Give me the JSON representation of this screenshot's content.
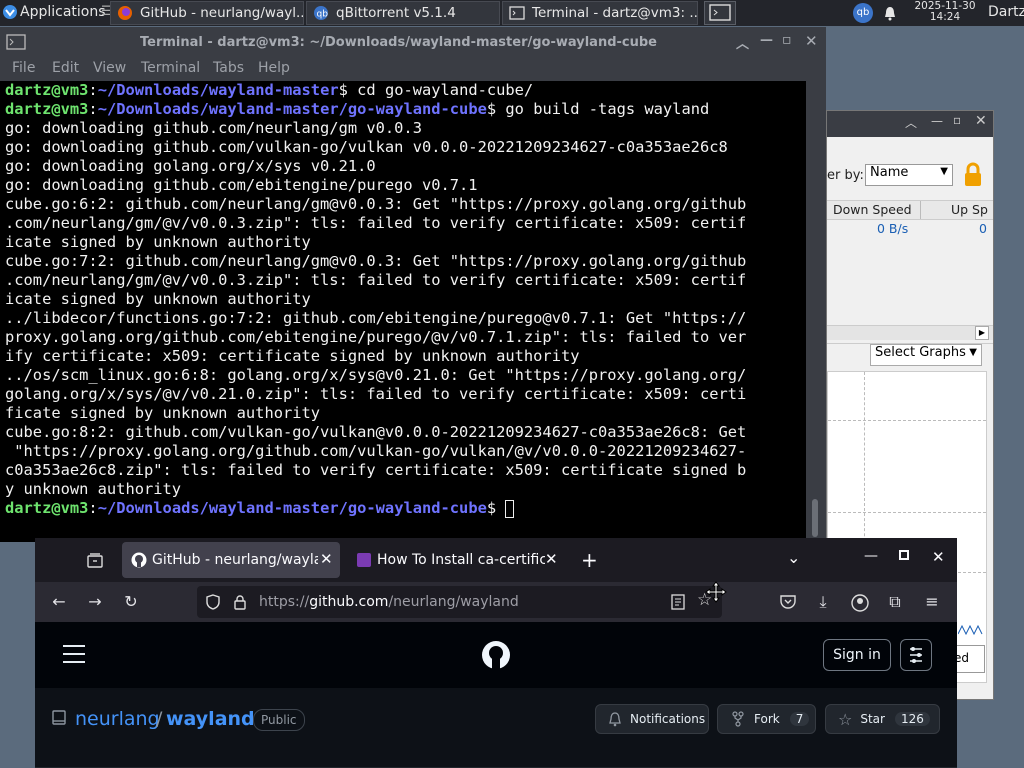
{
  "panel": {
    "applications_label": "Applications",
    "tasks": [
      {
        "label": "GitHub - neurlang/wayl..."
      },
      {
        "label": "qBittorrent v5.1.4"
      },
      {
        "label": "Terminal - dartz@vm3: ..."
      }
    ],
    "date": "2025-11-30",
    "time": "14:24",
    "user": "Dartz",
    "qb_tray": "qb"
  },
  "terminal": {
    "title": "Terminal - dartz@vm3: ~/Downloads/wayland-master/go-wayland-cube",
    "menu": [
      "File",
      "Edit",
      "View",
      "Terminal",
      "Tabs",
      "Help"
    ],
    "prompt_user": "dartz@vm3",
    "lines": [
      {
        "path": "~/Downloads/wayland-master",
        "cmd": "$ cd go-wayland-cube/"
      },
      {
        "path": "~/Downloads/wayland-master/go-wayland-cube",
        "cmd": "$ go build -tags wayland"
      }
    ],
    "output": [
      "go: downloading github.com/neurlang/gm v0.0.3",
      "go: downloading github.com/vulkan-go/vulkan v0.0.0-20221209234627-c0a353ae26c8",
      "go: downloading golang.org/x/sys v0.21.0",
      "go: downloading github.com/ebitengine/purego v0.7.1",
      "cube.go:6:2: github.com/neurlang/gm@v0.0.3: Get \"https://proxy.golang.org/github",
      ".com/neurlang/gm/@v/v0.0.3.zip\": tls: failed to verify certificate: x509: certif",
      "icate signed by unknown authority",
      "cube.go:7:2: github.com/neurlang/gm@v0.0.3: Get \"https://proxy.golang.org/github",
      ".com/neurlang/gm/@v/v0.0.3.zip\": tls: failed to verify certificate: x509: certif",
      "icate signed by unknown authority",
      "../libdecor/functions.go:7:2: github.com/ebitengine/purego@v0.7.1: Get \"https://",
      "proxy.golang.org/github.com/ebitengine/purego/@v/v0.7.1.zip\": tls: failed to ver",
      "ify certificate: x509: certificate signed by unknown authority",
      "../os/scm_linux.go:6:8: golang.org/x/sys@v0.21.0: Get \"https://proxy.golang.org/",
      "golang.org/x/sys/@v/v0.21.0.zip\": tls: failed to verify certificate: x509: certi",
      "ficate signed by unknown authority",
      "cube.go:8:2: github.com/vulkan-go/vulkan@v0.0.0-20221209234627-c0a353ae26c8: Get",
      " \"https://proxy.golang.org/github.com/vulkan-go/vulkan/@v/v0.0.0-20221209234627-",
      "c0a353ae26c8.zip\": tls: failed to verify certificate: x509: certificate signed b",
      "y unknown authority"
    ],
    "final_path": "~/Downloads/wayland-master/go-wayland-cube",
    "final_suffix": "$ "
  },
  "qbittorrent": {
    "filter_label": "er by:",
    "filter_value": "Name",
    "col_down": "Down Speed",
    "col_up": "Up Sp",
    "down_value": "0 B/s",
    "up_value": "0",
    "graphs_select": "Select Graphs",
    "btn_partial": "ed"
  },
  "firefox": {
    "tabs": [
      {
        "label": "GitHub - neurlang/waylan"
      },
      {
        "label": "How To Install ca-certifica"
      }
    ],
    "url_prefix": "https://",
    "url_main": "github.com",
    "url_rest": "/neurlang/wayland",
    "signin": "Sign in",
    "owner": "neurlang",
    "sep": "/",
    "repo": "wayland",
    "visibility": "Public",
    "notifications": "Notifications",
    "fork_label": "Fork",
    "fork_count": "7",
    "star_label": "Star",
    "star_count": "126"
  }
}
